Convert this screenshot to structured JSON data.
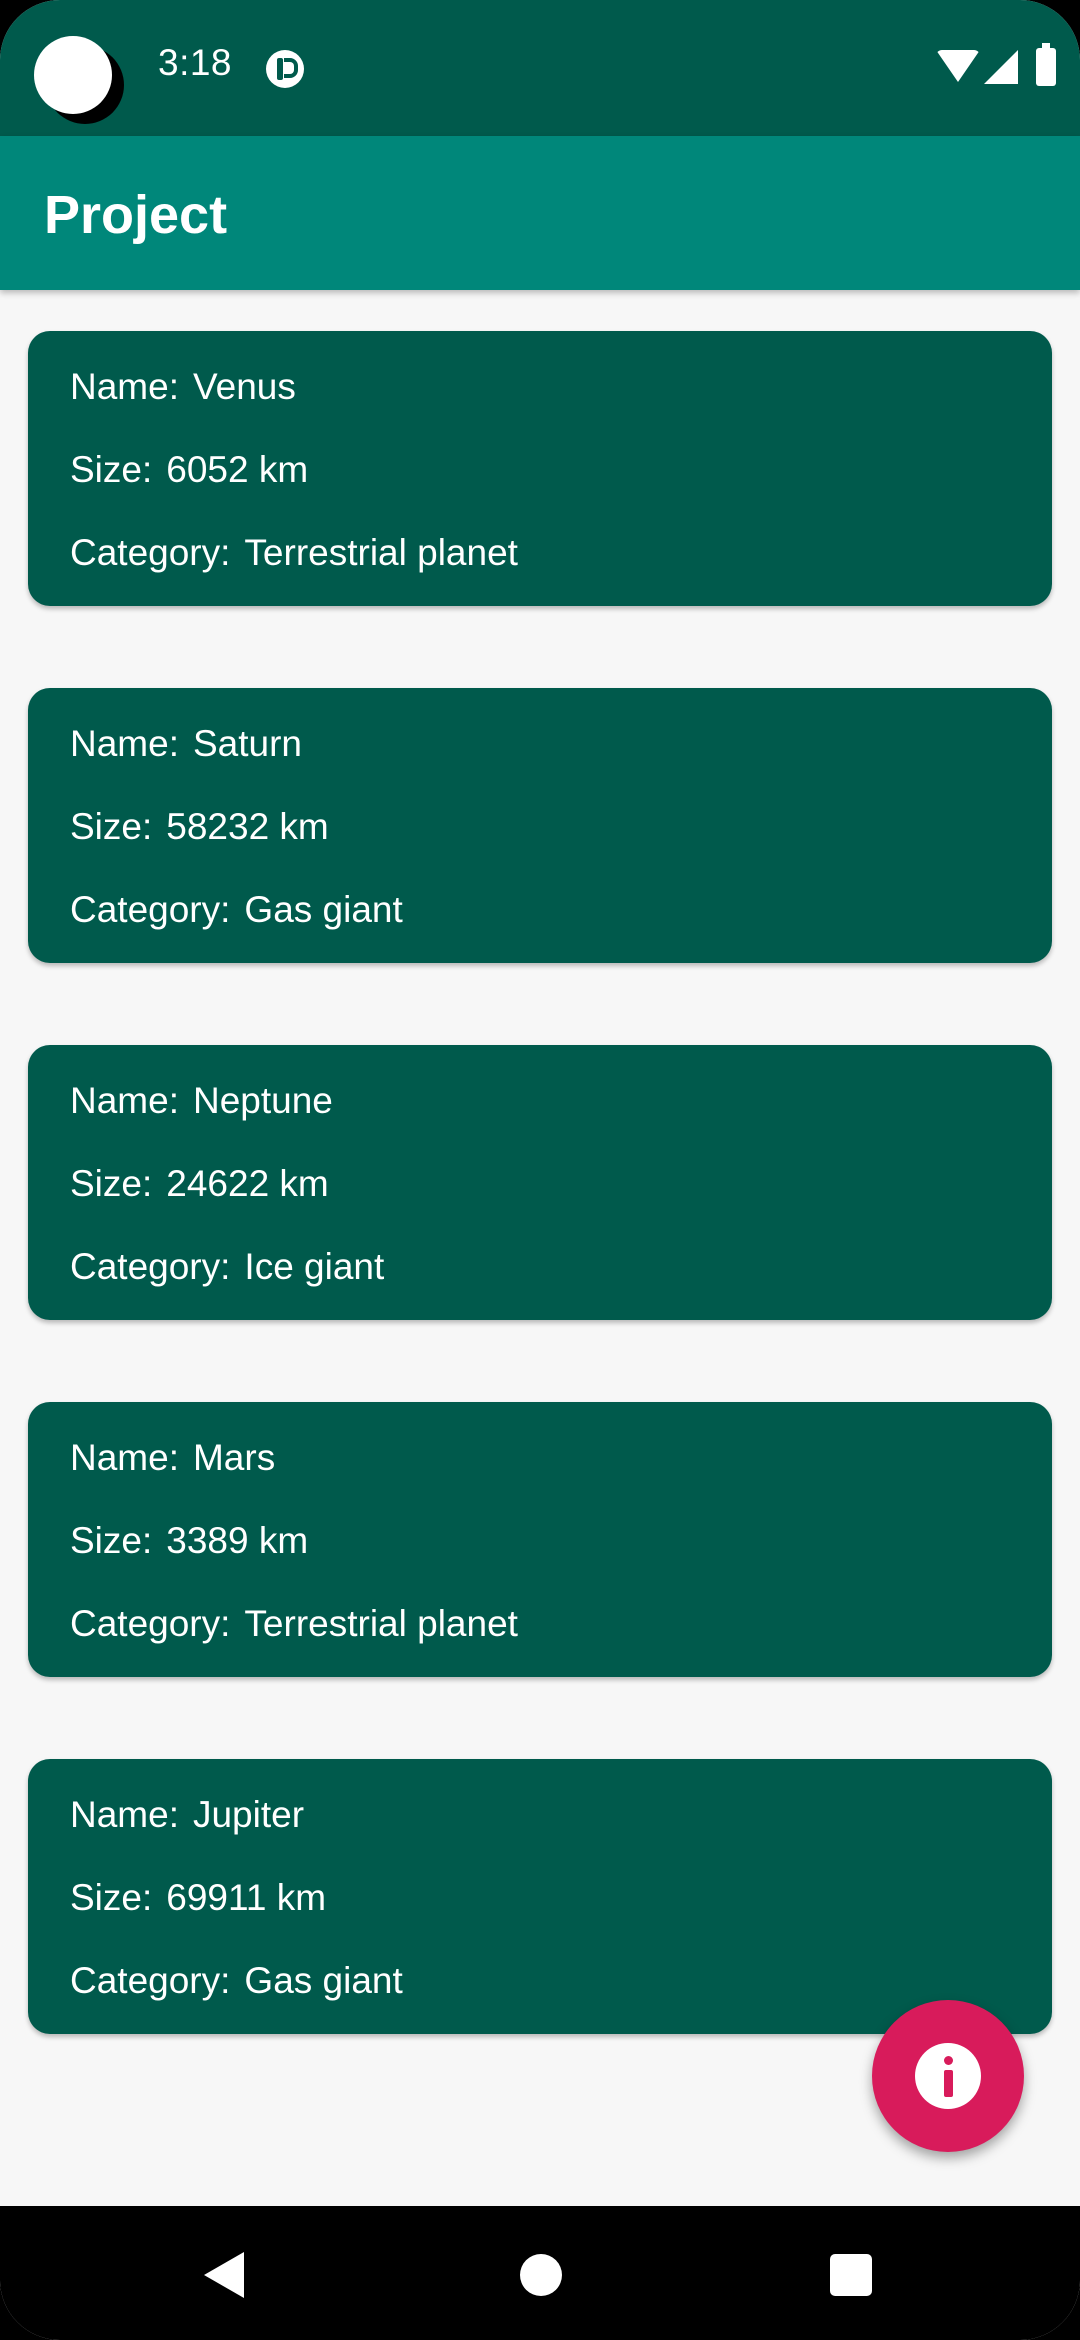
{
  "status_bar": {
    "time": "3:18",
    "icons": [
      "camera-cutout",
      "app-notification-icon",
      "wifi-icon",
      "signal-icon",
      "battery-icon"
    ]
  },
  "app_bar": {
    "title": "Project"
  },
  "labels": {
    "name": "Name:",
    "size": "Size:",
    "category": "Category:"
  },
  "planets": [
    {
      "name": "Venus",
      "size": "6052 km",
      "category": "Terrestrial planet"
    },
    {
      "name": "Saturn",
      "size": "58232 km",
      "category": "Gas giant"
    },
    {
      "name": "Neptune",
      "size": "24622 km",
      "category": "Ice giant"
    },
    {
      "name": "Mars",
      "size": "3389 km",
      "category": "Terrestrial planet"
    },
    {
      "name": "Jupiter",
      "size": "69911 km",
      "category": "Gas giant"
    }
  ],
  "fab": {
    "icon": "info-icon"
  },
  "nav_bar": {
    "icons": [
      "back-icon",
      "home-icon",
      "recents-icon"
    ]
  },
  "colors": {
    "status_bar": "#005a4c",
    "app_bar": "#00877a",
    "card": "#005a4c",
    "background": "#f7f7f7",
    "fab": "#d81b5b"
  }
}
